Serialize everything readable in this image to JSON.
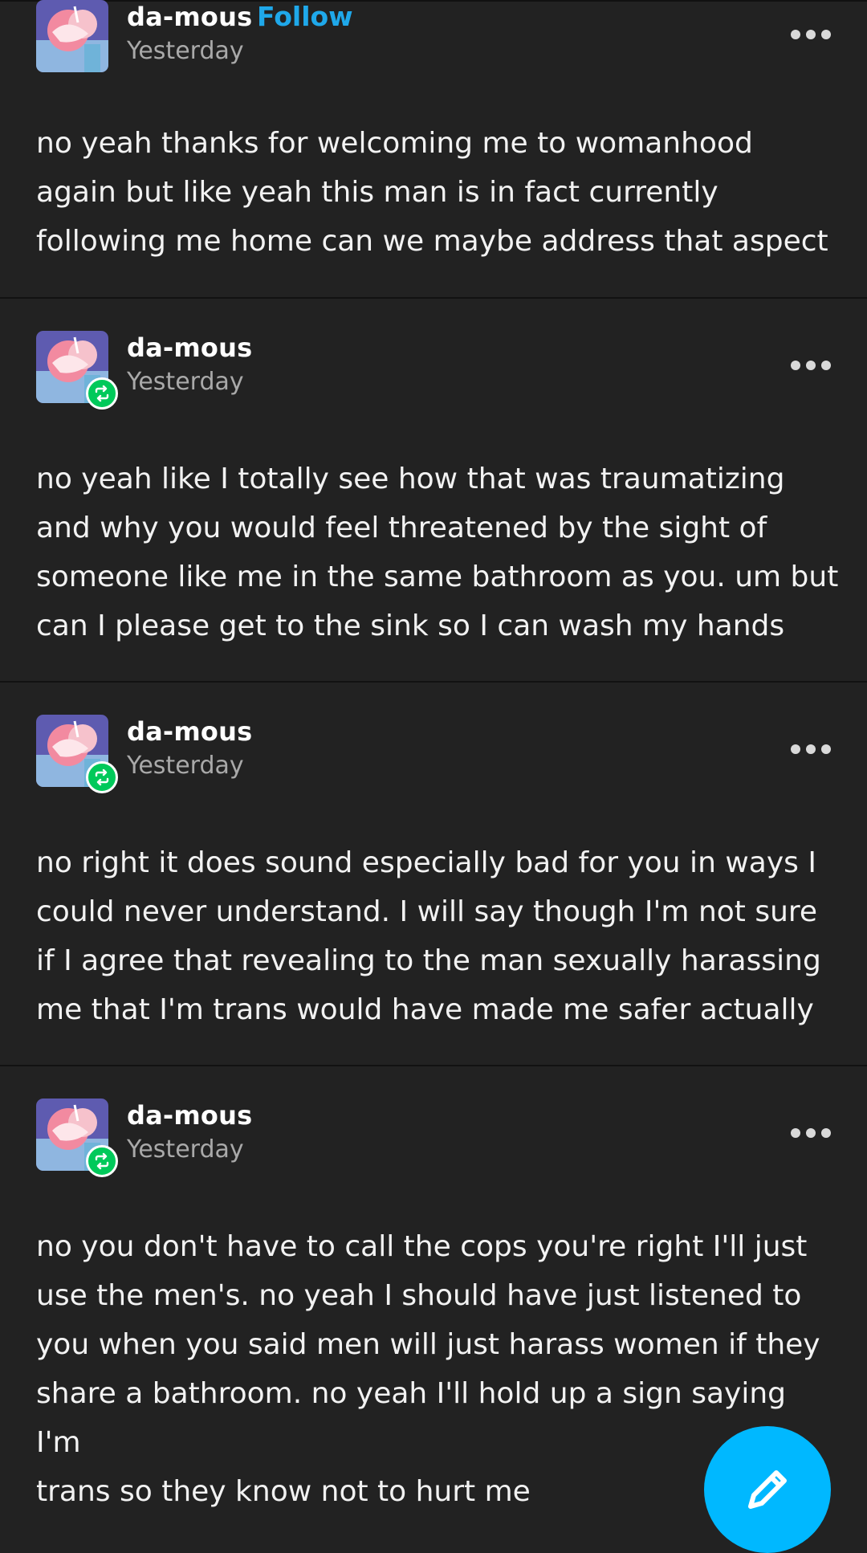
{
  "posts": [
    {
      "username": "da-mous",
      "follow_label": "Follow",
      "timestamp": "Yesterday",
      "text": "no yeah thanks for welcoming me to womanhood\nagain but like yeah this man is in fact currently\nfollowing me home can we maybe address that aspect"
    },
    {
      "username": "da-mous",
      "timestamp": "Yesterday",
      "reblog_icon": "reblog-icon",
      "text": "no yeah like I totally see how that was traumatizing\nand why you would feel threatened by the sight of\nsomeone like me in the same bathroom as you. um but\ncan I please get to the sink so I can wash my hands"
    },
    {
      "username": "da-mous",
      "timestamp": "Yesterday",
      "reblog_icon": "reblog-icon",
      "text": "no right it does sound especially bad for you in ways I\ncould never understand. I will say though I'm not sure\nif I agree that revealing to the man sexually harassing\nme that I'm trans would have made me safer actually"
    },
    {
      "username": "da-mous",
      "timestamp": "Yesterday",
      "reblog_icon": "reblog-icon",
      "text": "no you don't have to call the cops you're right I'll just\nuse the men's. no yeah I should have just listened to\nyou when you said men will just harass women if they\nshare a bathroom. no yeah I'll hold up a sign saying I'm\ntrans so they know not to hurt me"
    }
  ],
  "colors": {
    "background": "#222222",
    "follow": "#1fa8ea",
    "reblog_badge": "#00c95a",
    "fab": "#00b8ff",
    "timestamp": "#a9a9a9"
  },
  "icons": {
    "more": "more-options-icon",
    "compose": "pencil-icon"
  }
}
